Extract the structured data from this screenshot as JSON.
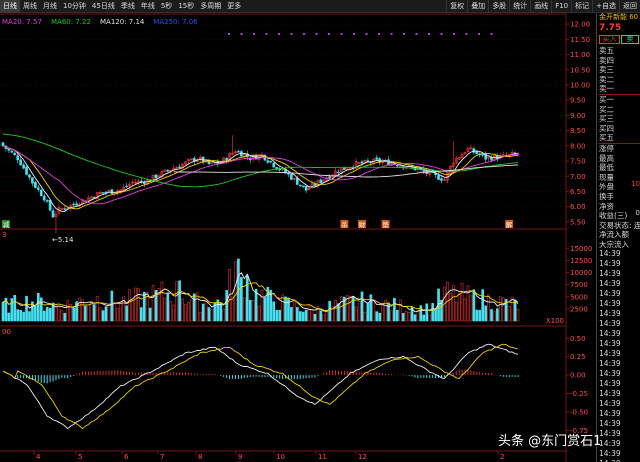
{
  "toolbar": {
    "left": [
      "日线",
      "周线",
      "月线",
      "10分钟",
      "45日线",
      "季线",
      "年线",
      "5秒",
      "15秒",
      "多周期",
      "更多"
    ],
    "active_index": 0,
    "right": [
      "复权",
      "叠加",
      "多股",
      "统计",
      "画线",
      "F10",
      "标记",
      "+自选",
      "返回"
    ]
  },
  "stock": {
    "title": "金开新能 60",
    "price": "7.75",
    "buy_label": "买入",
    "sell_label": "卖"
  },
  "ma_legend": [
    {
      "label": "MA20: 7.57",
      "color": "#e03ee0"
    },
    {
      "label": "MA60: 7.22",
      "color": "#1ec81e"
    },
    {
      "label": "MA120: 7.14",
      "color": "#e0e0e0"
    },
    {
      "label": "MA250: 7.06",
      "color": "#2a4cff"
    }
  ],
  "panel_rows": [
    "卖五",
    "卖四",
    "卖三",
    "卖二",
    "卖一",
    "买一",
    "买二",
    "买三",
    "买四",
    "买五",
    "涨停",
    "最高",
    "最低",
    "现量",
    "外盘",
    "换手",
    "净资",
    "收益(三)",
    "交易状态: 连",
    "净流入额",
    "大宗流入"
  ],
  "panel_time": "14:39",
  "panel_extra_values": [
    "10",
    "0"
  ],
  "watermark": "头条 @东门赏石1",
  "chart_data": {
    "type": "candlestick",
    "price_axis": {
      "ticks": [
        12.0,
        11.5,
        11.0,
        10.5,
        10.0,
        9.5,
        9.0,
        8.5,
        8.0,
        7.5,
        7.0,
        6.5,
        6.0,
        5.5
      ],
      "range": [
        5.3,
        12.3
      ]
    },
    "volume_axis": {
      "ticks": [
        15000,
        12500,
        10000,
        7500,
        5000,
        2500
      ],
      "unit_label": "X100",
      "range": [
        0,
        16500
      ]
    },
    "macd_axis": {
      "ticks": [
        0.5,
        0.25,
        0.0,
        -0.25,
        -0.5,
        -0.75
      ],
      "range": [
        -0.95,
        0.6
      ]
    },
    "x_labels": [
      "4",
      "5",
      "6",
      "7",
      "8",
      "9",
      "10",
      "11",
      "12",
      "2"
    ],
    "annotations": {
      "low_label": "←5.14",
      "low_value": 5.14,
      "markers": [
        "减",
        "杀",
        "财",
        "垫",
        "解"
      ],
      "volume_panel_label": "3",
      "macd_panel_label": "00"
    },
    "close_anchors": [
      [
        0,
        8.0
      ],
      [
        5,
        7.6
      ],
      [
        10,
        6.8
      ],
      [
        14,
        6.3
      ],
      [
        17,
        5.7
      ],
      [
        19,
        5.9
      ],
      [
        22,
        6.0
      ],
      [
        27,
        6.2
      ],
      [
        33,
        6.45
      ],
      [
        40,
        6.55
      ],
      [
        44,
        6.8
      ],
      [
        49,
        6.85
      ],
      [
        54,
        7.1
      ],
      [
        60,
        7.35
      ],
      [
        66,
        7.6
      ],
      [
        70,
        7.4
      ],
      [
        74,
        7.45
      ],
      [
        79,
        7.85
      ],
      [
        84,
        7.6
      ],
      [
        88,
        7.7
      ],
      [
        93,
        7.3
      ],
      [
        97,
        7.05
      ],
      [
        103,
        6.55
      ],
      [
        108,
        6.85
      ],
      [
        113,
        7.15
      ],
      [
        120,
        7.4
      ],
      [
        127,
        7.5
      ],
      [
        134,
        7.4
      ],
      [
        140,
        7.25
      ],
      [
        147,
        7.0
      ],
      [
        150,
        6.9
      ],
      [
        153,
        7.5
      ],
      [
        158,
        7.9
      ],
      [
        164,
        7.6
      ],
      [
        170,
        7.65
      ],
      [
        175,
        7.75
      ]
    ],
    "volume_anchors": [
      [
        0,
        3200
      ],
      [
        10,
        4200
      ],
      [
        20,
        3000
      ],
      [
        30,
        4800
      ],
      [
        40,
        4000
      ],
      [
        55,
        5800
      ],
      [
        60,
        6000
      ],
      [
        65,
        4000
      ],
      [
        75,
        3800
      ],
      [
        80,
        12800
      ],
      [
        85,
        5800
      ],
      [
        95,
        3800
      ],
      [
        105,
        2200
      ],
      [
        120,
        4200
      ],
      [
        130,
        3400
      ],
      [
        145,
        2500
      ],
      [
        150,
        5800
      ],
      [
        160,
        4800
      ],
      [
        175,
        3400
      ]
    ],
    "macd_dif_anchors": [
      [
        0,
        0.05
      ],
      [
        8,
        -0.12
      ],
      [
        15,
        -0.55
      ],
      [
        22,
        -0.72
      ],
      [
        30,
        -0.5
      ],
      [
        40,
        -0.15
      ],
      [
        52,
        0.08
      ],
      [
        62,
        0.3
      ],
      [
        72,
        0.38
      ],
      [
        80,
        0.15
      ],
      [
        90,
        0.02
      ],
      [
        100,
        -0.28
      ],
      [
        106,
        -0.4
      ],
      [
        118,
        0.02
      ],
      [
        128,
        0.22
      ],
      [
        136,
        0.25
      ],
      [
        145,
        0.05
      ],
      [
        150,
        -0.05
      ],
      [
        158,
        0.3
      ],
      [
        165,
        0.42
      ],
      [
        175,
        0.28
      ]
    ]
  },
  "colors": {
    "up": "#ff3b3b",
    "down": "#47e0f0",
    "grid": "#7a1414",
    "axis_text": "#ff4f4f"
  }
}
